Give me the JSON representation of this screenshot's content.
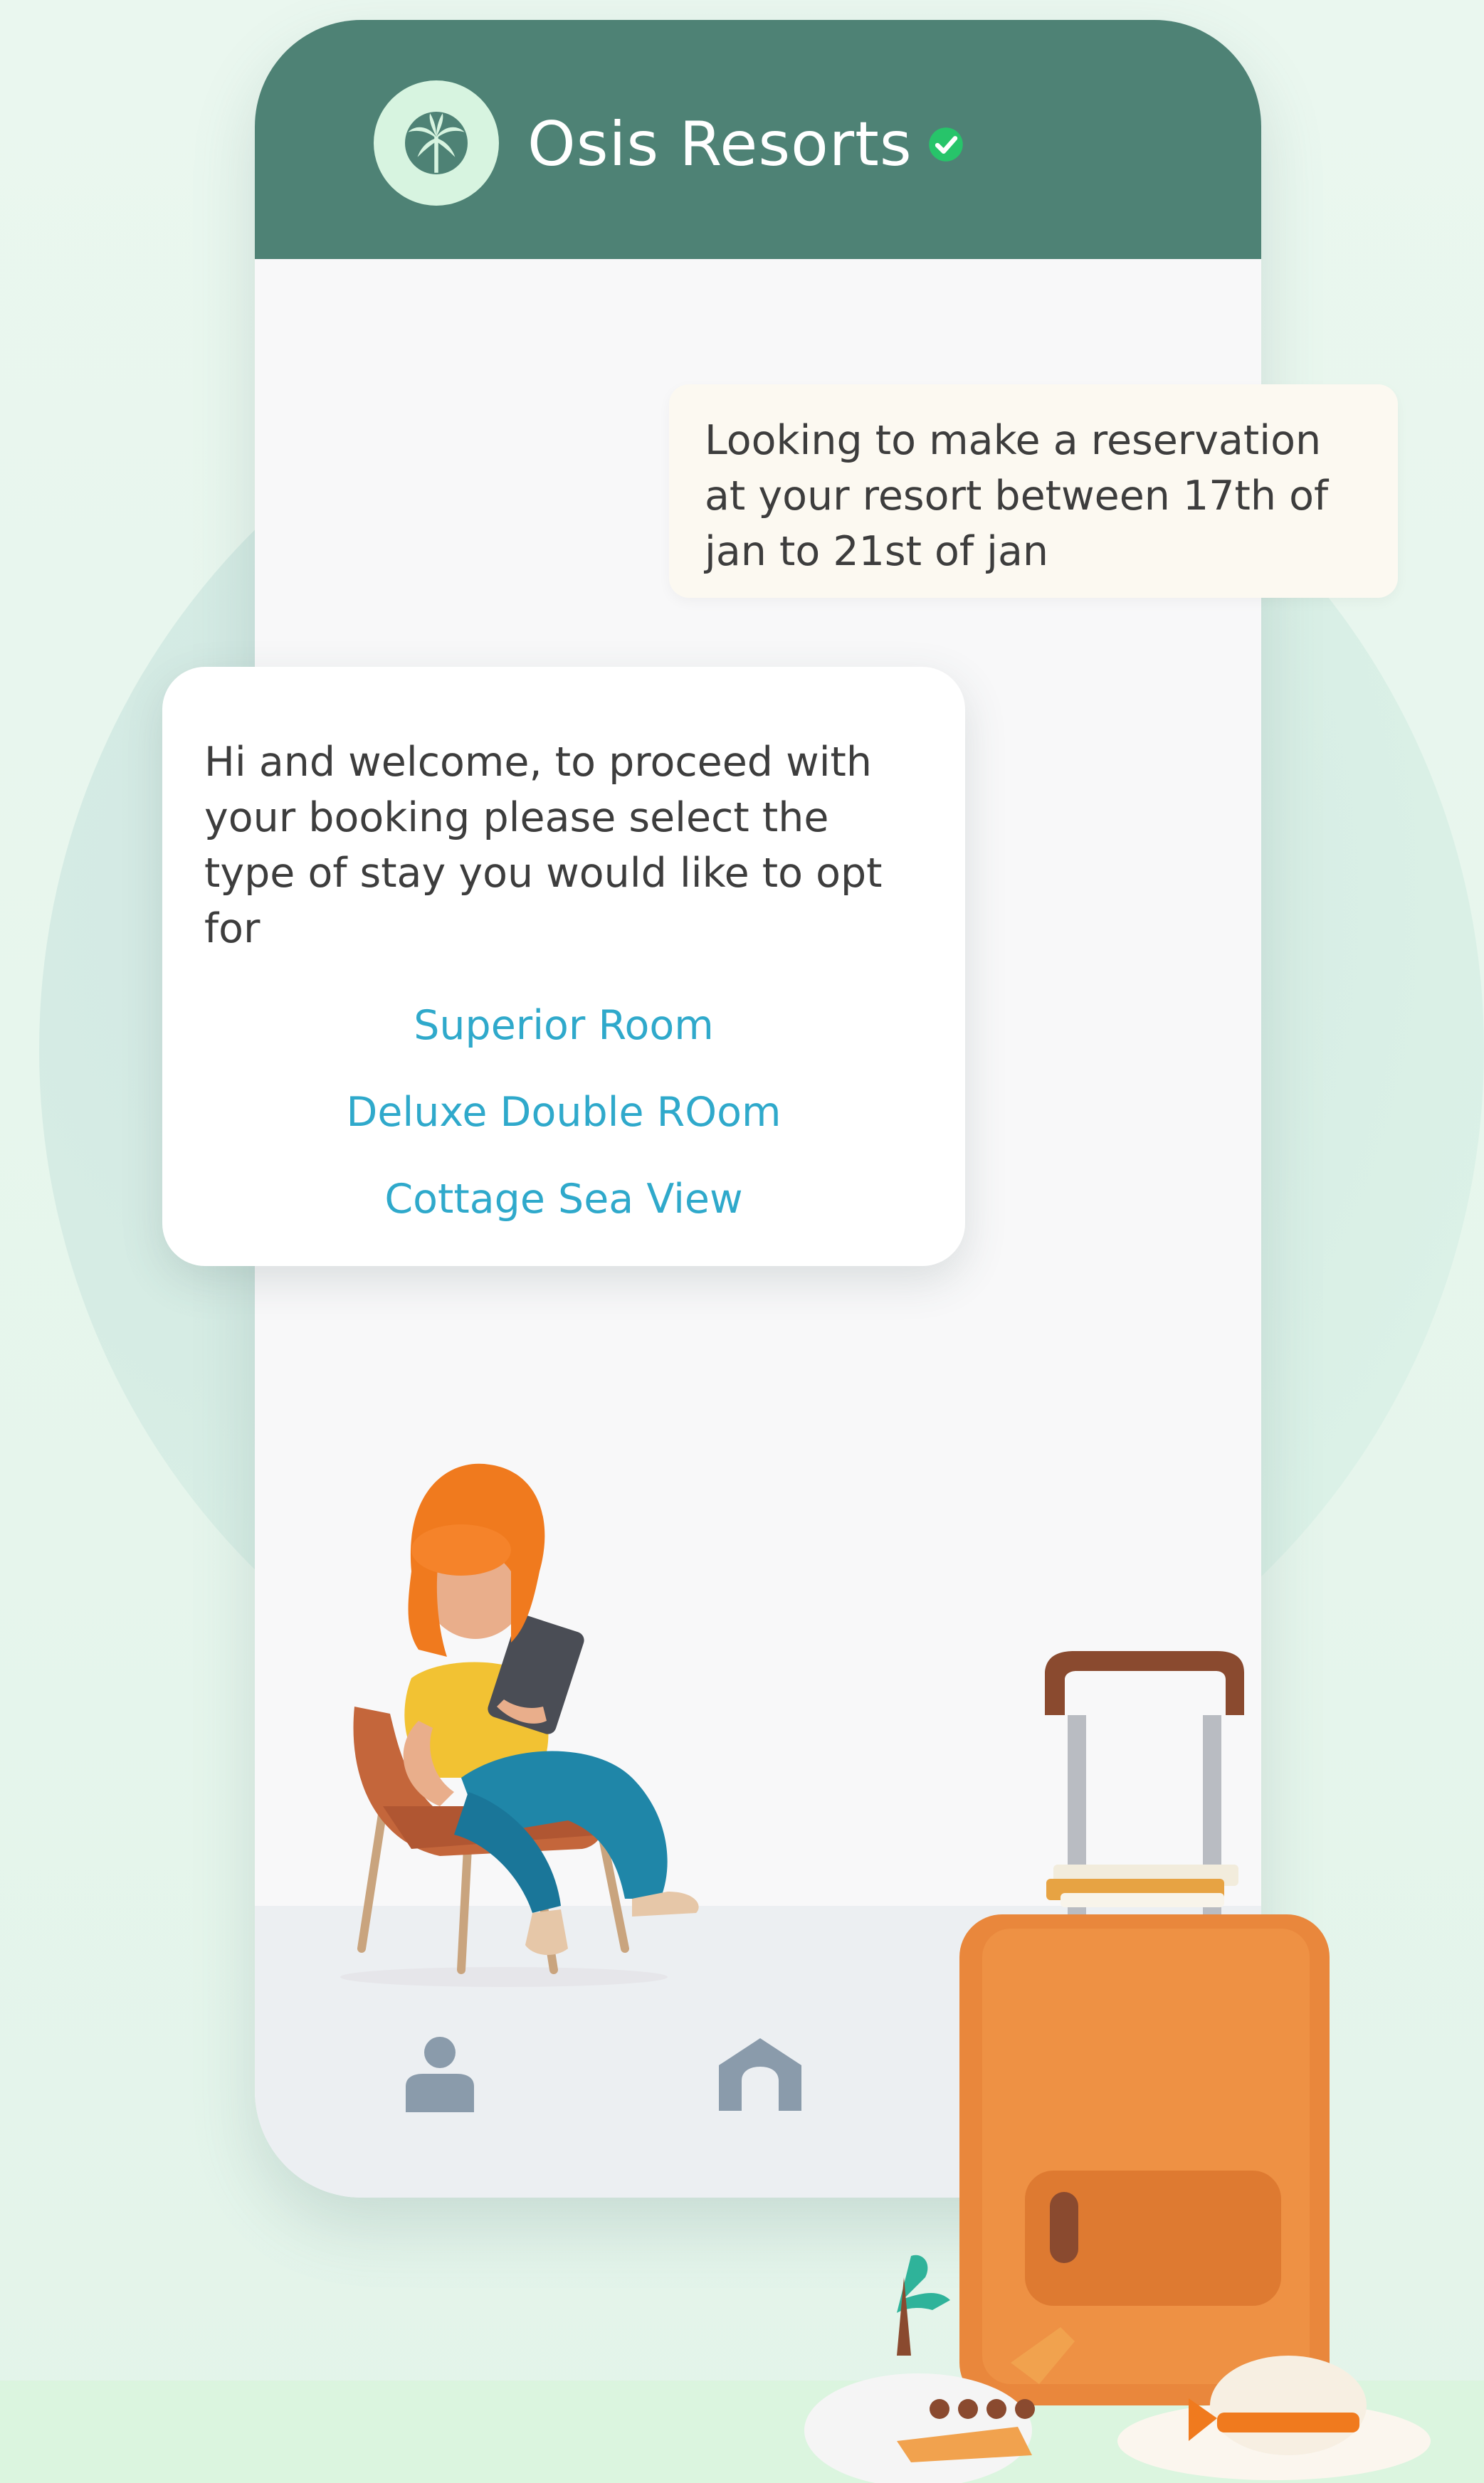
{
  "header": {
    "brand_name": "Osis Resorts",
    "logo_icon": "palm-tree-icon",
    "verified_icon": "verified-check-icon"
  },
  "chat": {
    "user_message": "Looking to make a reservation at your resort between 17th of jan to 21st of jan",
    "bot_message": "Hi and welcome, to proceed with your booking please select the type of stay you would like to opt for",
    "options": [
      {
        "label": "Superior Room"
      },
      {
        "label": "Deluxe Double ROom"
      },
      {
        "label": "Cottage Sea View"
      }
    ]
  },
  "bottom_nav": {
    "items": [
      {
        "icon": "profile-icon"
      },
      {
        "icon": "home-icon"
      }
    ]
  },
  "colors": {
    "header": "#4e8275",
    "link": "#2fa9cb",
    "verified": "#27c46a",
    "nav_icon": "#8a9bab"
  }
}
